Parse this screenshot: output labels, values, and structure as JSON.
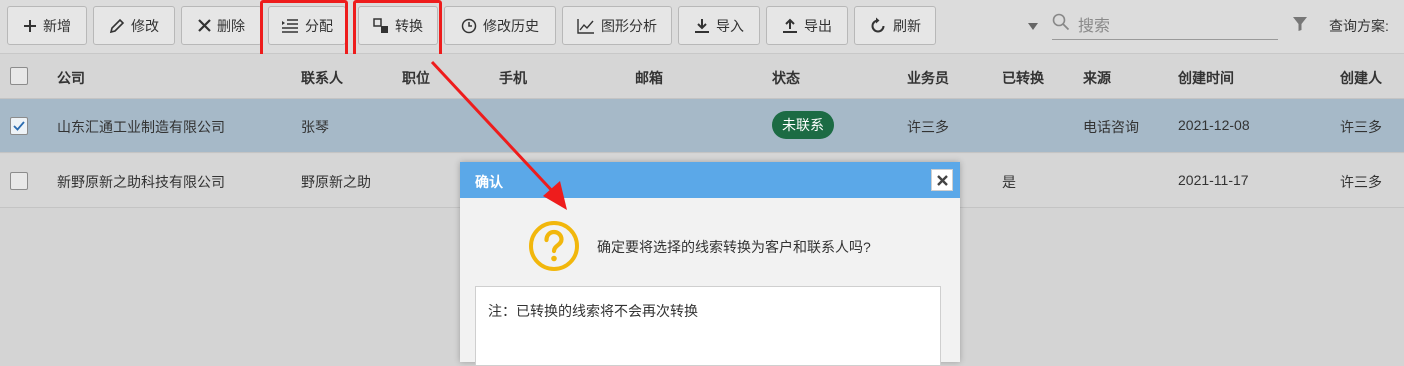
{
  "toolbar": {
    "buttons": [
      {
        "label": "新增",
        "icon": "plus-icon"
      },
      {
        "label": "修改",
        "icon": "pencil-icon"
      },
      {
        "label": "删除",
        "icon": "close-icon"
      },
      {
        "label": "分配",
        "icon": "assign-list-icon"
      },
      {
        "label": "转换",
        "icon": "convert-icon"
      },
      {
        "label": "修改历史",
        "icon": "clock-icon"
      },
      {
        "label": "图形分析",
        "icon": "line-chart-icon"
      },
      {
        "label": "导入",
        "icon": "download-icon"
      },
      {
        "label": "导出",
        "icon": "upload-icon"
      },
      {
        "label": "刷新",
        "icon": "refresh-icon"
      }
    ],
    "search_placeholder": "搜索",
    "scheme_label": "查询方案:",
    "highlight_color": "#ee1c1c"
  },
  "table": {
    "columns": [
      "公司",
      "联系人",
      "职位",
      "手机",
      "邮箱",
      "状态",
      "业务员",
      "已转换",
      "来源",
      "创建时间",
      "创建人"
    ],
    "rows": [
      {
        "selected": true,
        "company": "山东汇通工业制造有限公司",
        "contact": "张琴",
        "position": "",
        "mobile": "",
        "email": "",
        "status": "未联系",
        "salesperson": "许三多",
        "converted": "",
        "source": "电话咨询",
        "created_at": "2021-12-08",
        "creator": "许三多"
      },
      {
        "selected": false,
        "company": "新野原新之助科技有限公司",
        "contact": "野原新之助",
        "position": "",
        "mobile": "",
        "email": "",
        "status": "",
        "salesperson": "",
        "converted": "是",
        "source": "",
        "created_at": "2021-11-17",
        "creator": "许三多"
      }
    ],
    "status_color": "#1c6b44",
    "selected_row_color": "#a6b9c8"
  },
  "dialog": {
    "title": "确认",
    "message": "确定要将选择的线索转换为客户和联系人吗?",
    "note": "注：已转换的线索将不会再次转换",
    "icon": "question-icon",
    "header_color": "#5ba8e8"
  }
}
